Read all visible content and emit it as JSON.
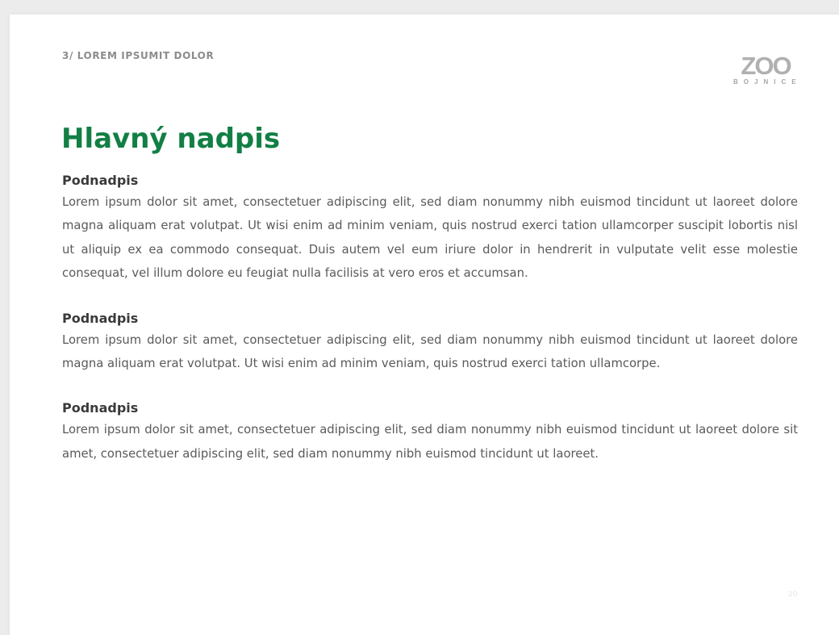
{
  "header": {
    "section_label": "3/ LOREM IPSUMIT DOLOR",
    "logo": {
      "word": "ZOO",
      "subtitle": "BOJNICE"
    }
  },
  "main": {
    "title": "Hlavný nadpis",
    "sections": [
      {
        "subheading": "Podnadpis",
        "text": "Lorem ipsum dolor sit amet, consectetuer adipiscing elit, sed diam nonummy nibh euismod tin­cidunt ut laoreet dolore magna aliquam erat volutpat. Ut wisi enim ad minim veniam, quis nos­trud exerci tation ullamcorper suscipit lobortis nisl ut aliquip ex ea commodo consequat. Duis autem vel eum iriure dolor in hendrerit in vulputate velit esse molestie consequat, vel illum dolore eu feugiat nulla facilisis at vero eros et accumsan."
      },
      {
        "subheading": "Podnadpis",
        "text": "Lorem ipsum dolor sit amet, consectetuer adipiscing elit, sed diam nonummy nibh euismod tin­cidunt ut laoreet dolore magna aliquam erat volutpat. Ut wisi enim ad minim veniam, quis nos­trud exerci tation ullamcorpe."
      },
      {
        "subheading": "Podnadpis",
        "text": "Lorem ipsum dolor sit amet, consectetuer adipiscing elit, sed diam nonummy nibh euismod tin­cidunt ut laoreet dolore sit amet, consectetuer adipiscing elit, sed diam nonummy nibh euis­mod tincidunt ut laoreet."
      }
    ]
  },
  "footer": {
    "page_number": "20"
  },
  "colors": {
    "title_green": "#127f44",
    "body_text": "#5a5a5a",
    "subheading": "#3a3a3a",
    "label_gray": "#8c8c8c",
    "logo_gray": "#b0b0b0"
  }
}
